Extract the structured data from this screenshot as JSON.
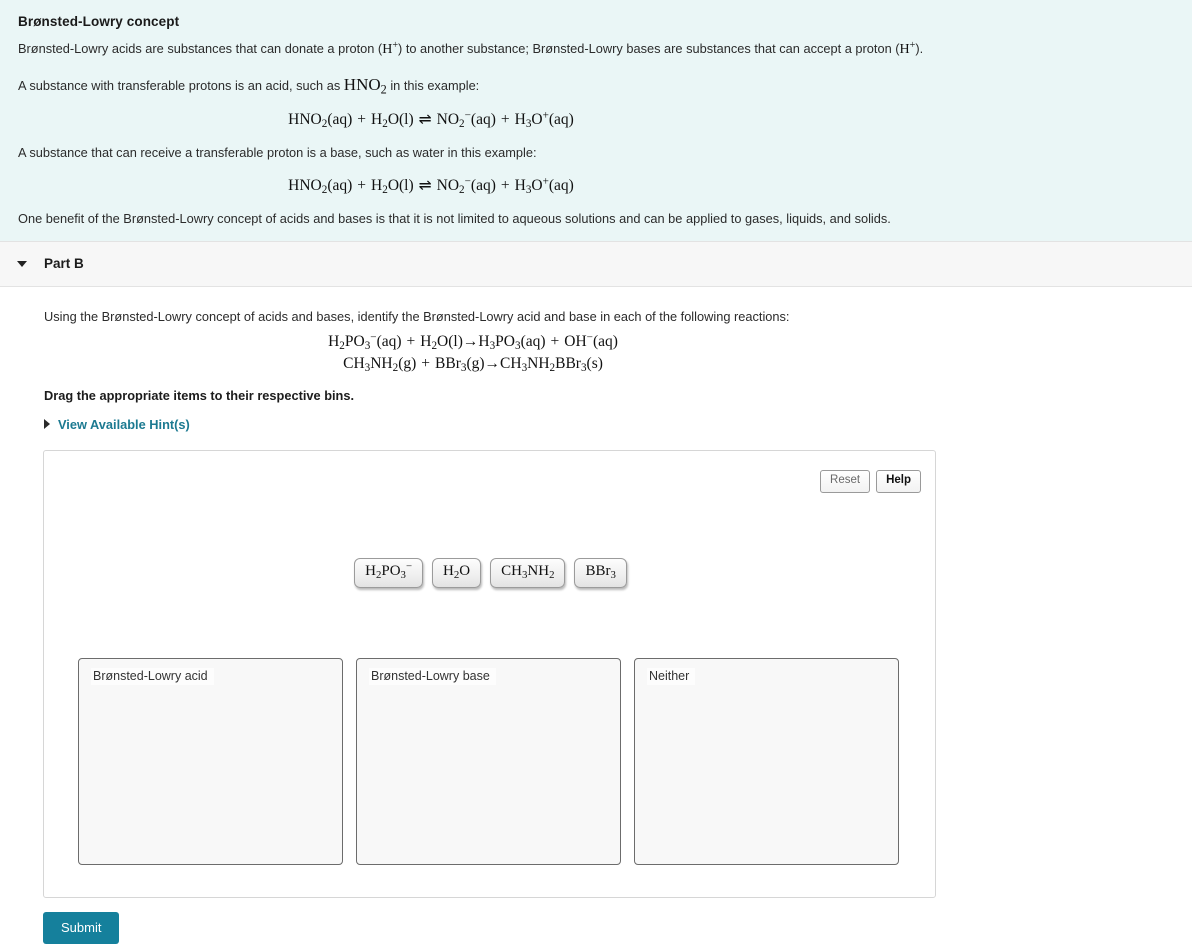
{
  "concept": {
    "title": "Brønsted-Lowry concept",
    "para1_a": "Brønsted-Lowry acids are substances that can donate a proton (",
    "para1_mid": ") to another substance; Brønsted-Lowry bases are substances that can accept a proton (",
    "para1_end": ").",
    "proton": "H⁺",
    "para2_a": "A substance with transferable protons is an acid, such as",
    "para2_species": "HNO₂",
    "para2_end": "in this example:",
    "equation1": "HNO₂(aq) + H₂O(l) ⇌ NO₂⁻(aq) + H₃O⁺(aq)",
    "para3": "A substance that can receive a transferable proton is a base, such as water in this example:",
    "equation2": "HNO₂(aq) + H₂O(l) ⇌ NO₂⁻(aq) + H₃O⁺(aq)",
    "para4": "One benefit of the Brønsted-Lowry concept of acids and bases is that it is not limited to aqueous solutions and can be applied to gases, liquids, and solids."
  },
  "part": {
    "title": "Part B",
    "caret_icon": "caret-down-icon",
    "prompt": "Using the Brønsted-Lowry concept of acids and bases, identify the Brønsted-Lowry acid and base in each of the following reactions:",
    "reaction1": "H₂PO₃⁻(aq) + H₂O(l)→H₃PO₃(aq) + OH⁻(aq)",
    "reaction2": "CH₃NH₂(g) + BBr₃(g)→CH₃NH₂BBr₃(s)",
    "drag_instruction": "Drag the appropriate items to their respective bins.",
    "hint_label": "View Available Hint(s)",
    "hint_caret_icon": "caret-right-icon"
  },
  "answer_panel": {
    "reset_label": "Reset",
    "help_label": "Help",
    "tiles": [
      {
        "id": "h2po3",
        "label": "H₂PO₃⁻"
      },
      {
        "id": "h2o",
        "label": "H₂O"
      },
      {
        "id": "ch3nh2",
        "label": "CH₃NH₂"
      },
      {
        "id": "bbr3",
        "label": "BBr₃"
      }
    ],
    "bins": [
      {
        "id": "acid",
        "label": "Brønsted-Lowry acid",
        "contents": []
      },
      {
        "id": "base",
        "label": "Brønsted-Lowry base",
        "contents": []
      },
      {
        "id": "neither",
        "label": "Neither",
        "contents": []
      }
    ]
  },
  "submit": {
    "label": "Submit"
  },
  "colors": {
    "concept_bg": "#eaf6f6",
    "part_header_bg": "#f7f7f7",
    "hint_link": "#1c7a91",
    "submit_bg": "#15809c",
    "bin_bg": "#f8f8f8",
    "bin_border": "#6c6c6c"
  }
}
